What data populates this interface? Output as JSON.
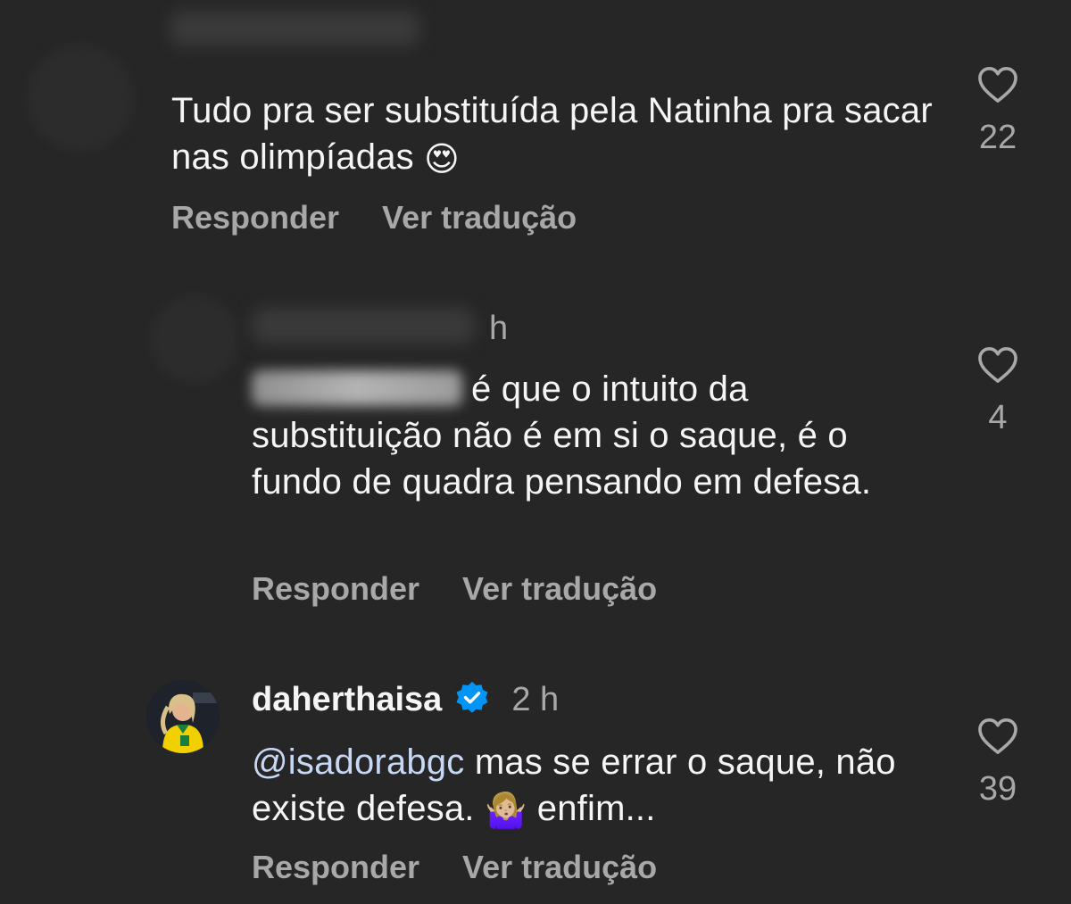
{
  "comments": [
    {
      "text": "Tudo pra ser substituída pela Natinha pra sacar nas olimpíadas",
      "emoji": "😍",
      "reply_label": "Responder",
      "translate_label": "Ver tradução",
      "likes": "22"
    },
    {
      "time": "h",
      "text": "é que o intuito da substituição não é em si o saque, é o fundo de quadra pensando em defesa.",
      "reply_label": "Responder",
      "translate_label": "Ver tradução",
      "likes": "4"
    },
    {
      "username": "daherthaisa",
      "time": "2 h",
      "mention": "@isadorabgc",
      "text_part1": " mas se errar o saque, não existe defesa.",
      "emoji": "🤷🏼‍♀️",
      "text_part2": " enfim...",
      "reply_label": "Responder",
      "translate_label": "Ver tradução",
      "likes": "39"
    }
  ],
  "icons": {
    "like": "heart-outline-icon",
    "verified": "verified-badge-icon"
  },
  "colors": {
    "background": "#262626",
    "primary_text": "#f5f5f5",
    "secondary_text": "#a8a8a8",
    "mention": "#c7d8f5",
    "verified": "#0095f6",
    "jersey": "#f2d000"
  }
}
